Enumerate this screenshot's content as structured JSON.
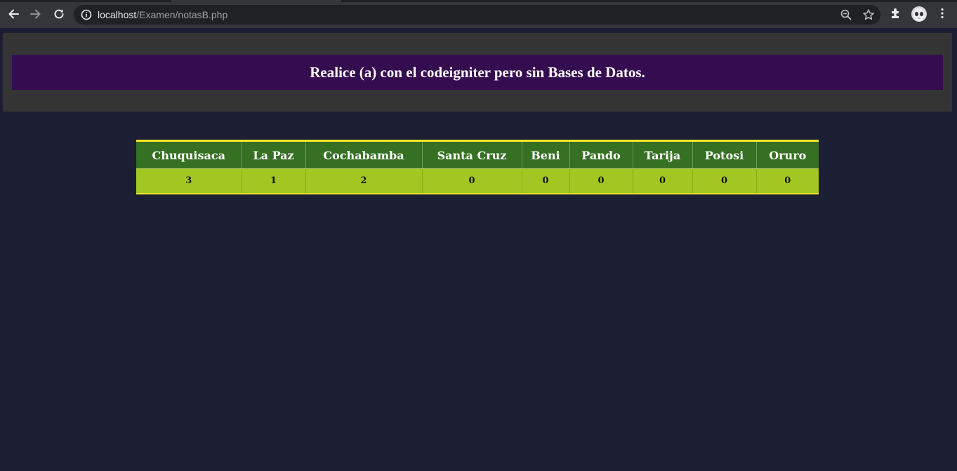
{
  "browser": {
    "url_host": "localhost",
    "url_path": "/Examen/notasB.php",
    "icons": [
      "back-arrow-icon",
      "forward-arrow-icon",
      "reload-icon",
      "info-icon",
      "zoom-icon",
      "star-icon",
      "extensions-icon",
      "avatar",
      "menu-dots-icon"
    ]
  },
  "page": {
    "title": "Realice (a) con el codeigniter pero sin Bases de Datos."
  },
  "table": {
    "headers": [
      "Chuquisaca",
      "La Paz",
      "Cochabamba",
      "Santa Cruz",
      "Beni",
      "Pando",
      "Tarija",
      "Potosi",
      "Oruro"
    ],
    "row": [
      "3",
      "1",
      "2",
      "0",
      "0",
      "0",
      "0",
      "0",
      "0"
    ]
  },
  "colors": {
    "page_bg": "#1c1f33",
    "title_bg": "#360c50",
    "header_bg": "#367023",
    "cell_bg": "#a3c722",
    "accent_border": "#f5e42a"
  }
}
